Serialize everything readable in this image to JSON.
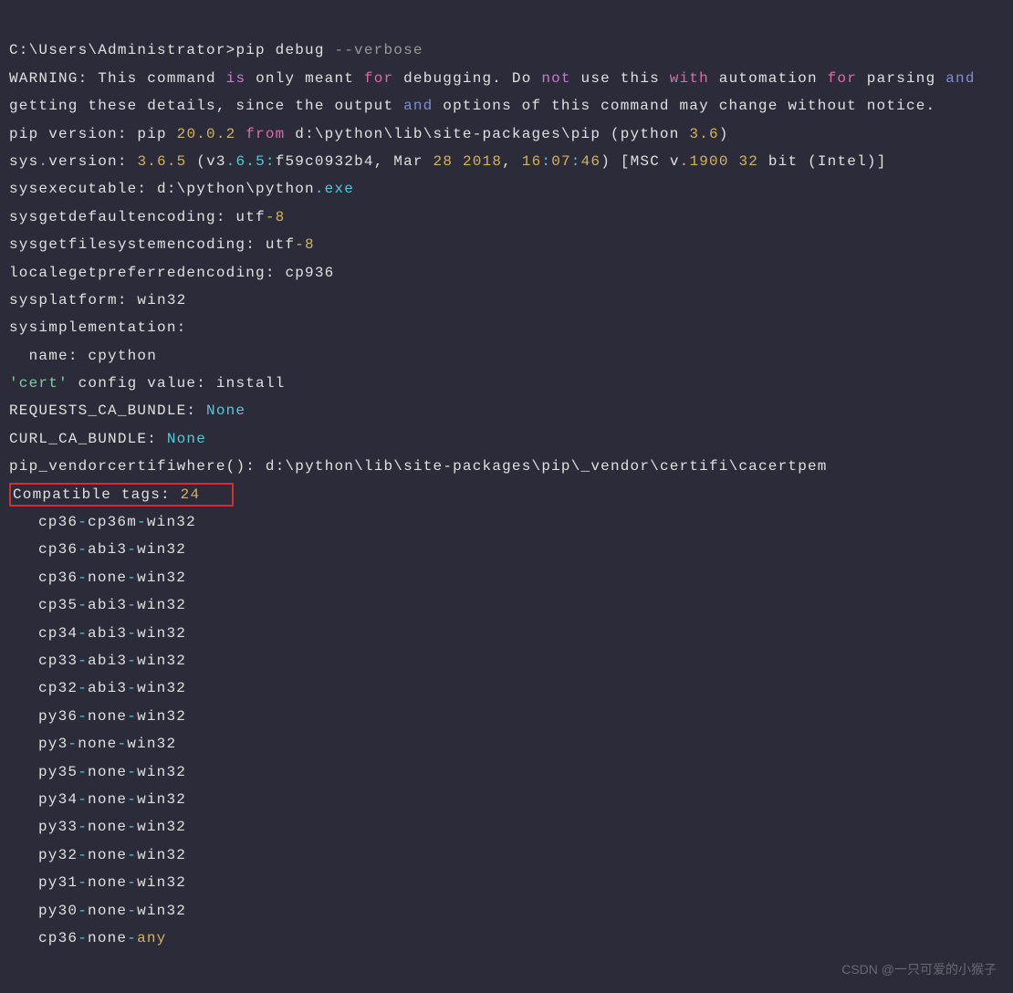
{
  "prompt": {
    "path": "C:\\Users\\Administrator>",
    "cmd": "pip debug ",
    "flag": "--verbose"
  },
  "warning": {
    "tag": "WARNING",
    "p1": ": This command ",
    "p2": "is",
    "p3": " only meant ",
    "p4": "for",
    "p5": " debugging. Do ",
    "p6": "not",
    "p7": " use this ",
    "p8": "with",
    "p9": " automation ",
    "p10": "for",
    "p11": " parsing ",
    "p12": "and",
    "p13": " getting these details, since the output ",
    "p14": "and",
    "p15": " options of this command may change without notice."
  },
  "pipver": {
    "p1": "pip version: pip ",
    "ver": "20.0.2",
    "from": " from",
    "path": " d:\\python\\lib\\site-packages\\pip (python ",
    "pyver": "3.6",
    "close": ")"
  },
  "sysver": {
    "key": "sys",
    "dot": ".",
    "label": "version: ",
    "ver": "3.6.5",
    "open": " (",
    "vtag": "v3",
    "dots": ".6.5:",
    "hash": "f59c0932b4",
    "comma": ", Mar ",
    "d1": "28",
    "sp": " ",
    "d2": "2018",
    "comma2": ", ",
    "t1": "16",
    "colon": ":",
    "t2": "07",
    "t3": "46",
    "close": ") [",
    "msc": "MSC v",
    "mscn": ".1900 32",
    "bit": " bit (Intel)",
    "br": "]"
  },
  "exe": {
    "k": "sys",
    ".": ".",
    "l": "executable: d:\\python\\python",
    "ext": ".exe"
  },
  "defenc": {
    "k": "sys",
    ".": ".",
    "l": "getdefaultencoding: utf",
    "n": "-8"
  },
  "fsenc": {
    "k": "sys",
    ".": ".",
    "l": "getfilesystemencoding: utf",
    "n": "-8"
  },
  "locale": {
    "k": "locale",
    ".": ".",
    "l": "getpreferredencoding: cp936"
  },
  "platform": {
    "k": "sys",
    ".": ".",
    "l": "platform: win32"
  },
  "impl": {
    "k": "sys",
    ".": ".",
    "l": "implementation:",
    "name": "  name: cpython"
  },
  "cert": {
    "q": "'cert'",
    "l": " config value: install"
  },
  "req": {
    "k": "REQUESTS_CA_BUNDLE: ",
    "v": "None"
  },
  "curl": {
    "k": "CURL_CA_BUNDLE: ",
    "v": "None"
  },
  "certifi": {
    "p": "pip",
    ".": ".",
    "v": "_vendor",
    ".2": ".",
    "c": "certifi",
    ".3": ".",
    "w": "where",
    "par": "(): ",
    "path": "d:\\python\\lib\\site-packages\\pip\\_vendor\\certifi\\cacert",
    ".4": ".",
    "ext": "pem"
  },
  "compat": {
    "k": "Compatible tags: ",
    "n": "24"
  },
  "tags": [
    "cp36-cp36m-win32",
    "cp36-abi3-win32",
    "cp36-none-win32",
    "cp35-abi3-win32",
    "cp34-abi3-win32",
    "cp33-abi3-win32",
    "cp32-abi3-win32",
    "py36-none-win32",
    "py3-none-win32",
    "py35-none-win32",
    "py34-none-win32",
    "py33-none-win32",
    "py32-none-win32",
    "py31-none-win32",
    "py30-none-win32"
  ],
  "lasttag": {
    "a": "cp36",
    "d1": "-",
    "b": "none",
    "d2": "-",
    "c": "any"
  },
  "watermark": "CSDN @一只可爱的小猴子"
}
